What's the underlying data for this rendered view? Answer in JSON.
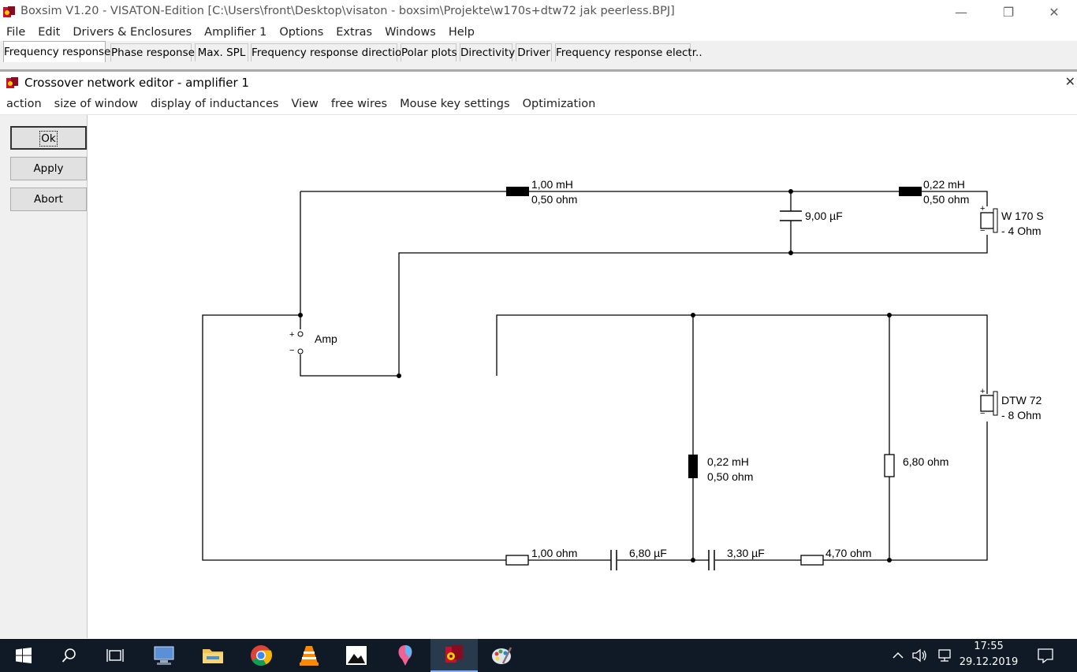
{
  "window": {
    "title": "Boxsim V1.20 - VISATON-Edition [C:\\Users\\front\\Desktop\\visaton - boxsim\\Projekte\\w170s+dtw72 jak peerless.BPJ]",
    "minimize": "—",
    "maximize": "❐",
    "close": "✕"
  },
  "menu": [
    "File",
    "Edit",
    "Drivers & Enclosures",
    "Amplifier 1",
    "Options",
    "Extras",
    "Windows",
    "Help"
  ],
  "tabs": [
    {
      "label": "Frequency response.",
      "active": true
    },
    {
      "label": "Phase response"
    },
    {
      "label": "Max. SPL"
    },
    {
      "label": "Frequency response directions"
    },
    {
      "label": "Polar plots"
    },
    {
      "label": "Directivity"
    },
    {
      "label": "Driver"
    },
    {
      "label": "Frequency response electr.."
    }
  ],
  "editor": {
    "title": "Crossover network editor - amplifier 1",
    "close": "✕",
    "menu": [
      "action",
      "size of window",
      "display of inductances",
      "View",
      "free wires",
      "Mouse key settings",
      "Optimization"
    ],
    "buttons": {
      "ok": "Ok",
      "apply": "Apply",
      "abort": "Abort"
    }
  },
  "circuit": {
    "amp_label": "Amp",
    "amp_plus": "+",
    "amp_minus": "−",
    "l1_value": "1,00 mH",
    "l1_res": "0,50 ohm",
    "c1_value": "9,00 µF",
    "l2_value": "0,22 mH",
    "l2_res": "0,50 ohm",
    "woofer_name": "W 170 S",
    "woofer_imp": "- 4 Ohm",
    "tweeter_name": "DTW 72",
    "tweeter_imp": "- 8 Ohm",
    "l3_value": "0,22 mH",
    "l3_res": "0,50 ohm",
    "r_shunt": "6,80 ohm",
    "r1_value": "1,00 ohm",
    "c2_value": "6,80 µF",
    "c3_value": "3,30 µF",
    "r2_value": "4,70 ohm",
    "plus": "+",
    "minus": "−"
  },
  "taskbar": {
    "time": "17:55",
    "date": "29.12.2019"
  },
  "colors": {
    "taskbar": "#0f1a26",
    "wire": "#000000",
    "inductor": "#000000"
  }
}
